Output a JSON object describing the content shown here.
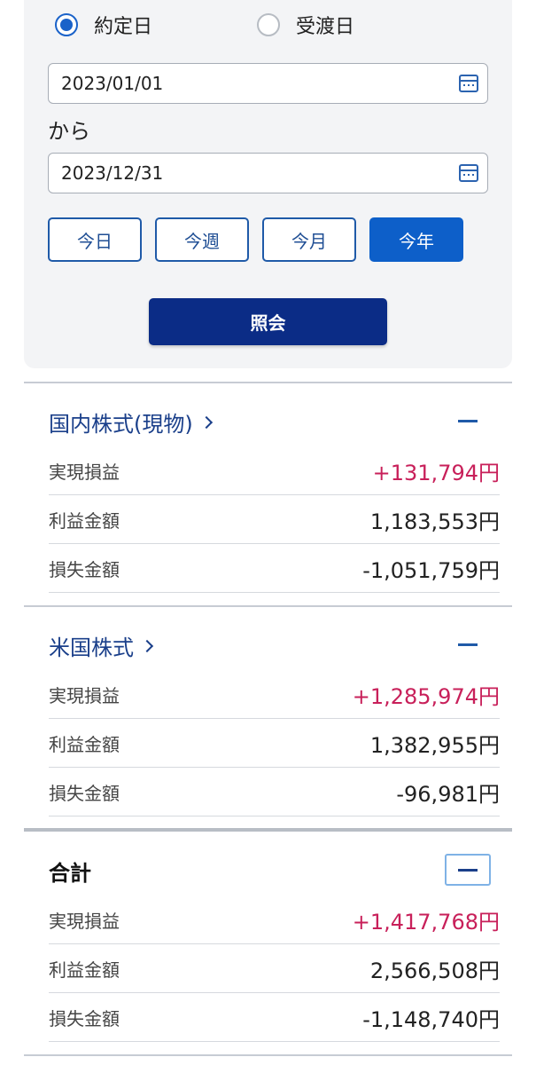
{
  "filter": {
    "date_type_options": [
      {
        "label": "約定日",
        "selected": true
      },
      {
        "label": "受渡日",
        "selected": false
      }
    ],
    "from_date": "2023/01/01",
    "from_label": "から",
    "to_date": "2023/12/31",
    "quick_buttons": [
      {
        "label": "今日",
        "active": false
      },
      {
        "label": "今週",
        "active": false
      },
      {
        "label": "今月",
        "active": false
      },
      {
        "label": "今年",
        "active": true
      }
    ],
    "submit_label": "照会"
  },
  "sections": [
    {
      "title": "国内株式(現物)",
      "rows": [
        {
          "label": "実現損益",
          "value": "+131,794円",
          "profit": true
        },
        {
          "label": "利益金額",
          "value": "1,183,553円",
          "profit": false
        },
        {
          "label": "損失金額",
          "value": "-1,051,759円",
          "profit": false
        }
      ]
    },
    {
      "title": "米国株式",
      "rows": [
        {
          "label": "実現損益",
          "value": "+1,285,974円",
          "profit": true
        },
        {
          "label": "利益金額",
          "value": "1,382,955円",
          "profit": false
        },
        {
          "label": "損失金額",
          "value": "-96,981円",
          "profit": false
        }
      ]
    },
    {
      "title": "合計",
      "rows": [
        {
          "label": "実現損益",
          "value": "+1,417,768円",
          "profit": true
        },
        {
          "label": "利益金額",
          "value": "2,566,508円",
          "profit": false
        },
        {
          "label": "損失金額",
          "value": "-1,148,740円",
          "profit": false
        }
      ]
    }
  ],
  "colors": {
    "accent": "#0d5fc9",
    "submit": "#0b2c86",
    "profit": "#c8205a",
    "section_title": "#1a3f8a"
  },
  "icons": {
    "date_picker": "calendar-icon",
    "section_link": "chevron-right-icon",
    "collapse": "minus-icon"
  }
}
